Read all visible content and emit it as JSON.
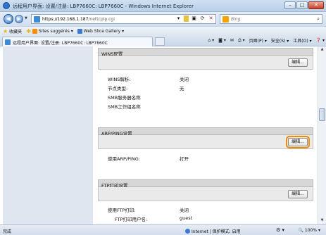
{
  "window": {
    "title": "远程用户界面: 设置/注册: LBP7660C: LBP7660C - Windows Internet Explorer"
  },
  "window_buttons": {
    "minimize": "–",
    "maximize": "□",
    "close": "✕"
  },
  "address": {
    "host": "https://192.168.1.187",
    "path": "/nettcpip.cgi",
    "search_placeholder": "Bing"
  },
  "favorites": {
    "favorites_label": "收藏夹",
    "suggested_label": "Sites suggérés ▾",
    "webslice_label": "Web Slice Gallery ▾"
  },
  "tab": {
    "label": "远程用户界面: 设置/注册: LBP7660C: LBP7660C"
  },
  "commands": {
    "page": "页面(P) ▾",
    "safety": "安全(S) ▾",
    "tools": "工具(O) ▾",
    "help": "❓ ▾"
  },
  "sections": {
    "wins": {
      "title": "WINS配置",
      "edit": "编辑...",
      "rows": [
        {
          "label": "WINS解析:",
          "value": "关闭"
        },
        {
          "label": "节点类型:",
          "value": "无"
        },
        {
          "label": "SMB服务器名称",
          "value": ""
        },
        {
          "label": "SMB工作组名称",
          "value": ""
        }
      ]
    },
    "arp": {
      "title": "ARP/PING设置",
      "edit": "编辑...",
      "rows": [
        {
          "label": "使用ARP/PING:",
          "value": "打开"
        }
      ]
    },
    "ftp": {
      "title": "FTP打印设置",
      "edit": "编辑...",
      "rows": [
        {
          "label": "使用FTP打印:",
          "value": "关闭"
        },
        {
          "label": "FTP打印用户名:",
          "value": "guest"
        }
      ]
    }
  },
  "status": {
    "left": "完成",
    "zone": "Internet | 保护模式: 启用",
    "zoom": "🔍 100% ▾"
  }
}
